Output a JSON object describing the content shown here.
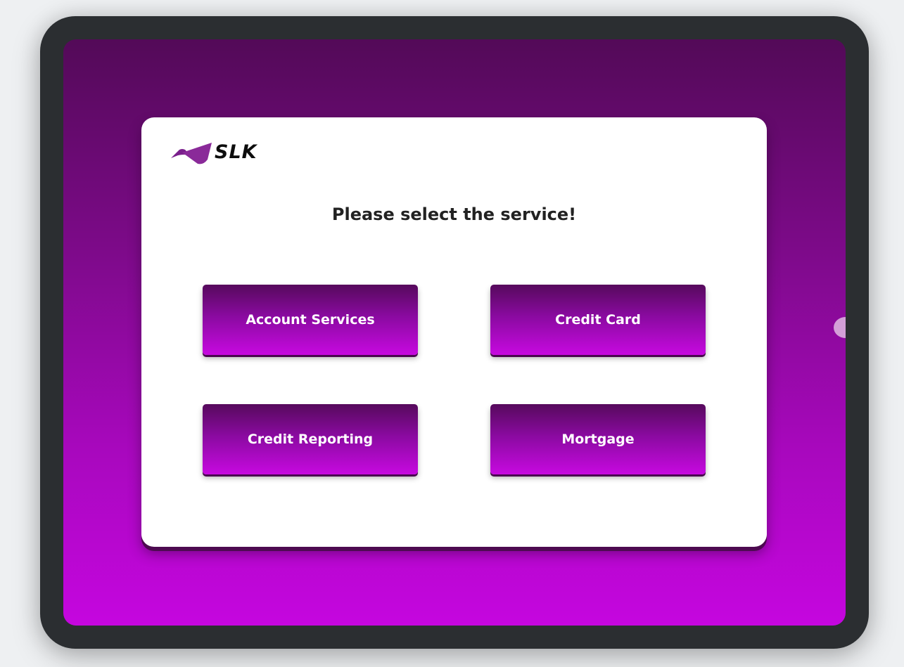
{
  "logo": {
    "text": "SLK",
    "accent_color": "#8a2a99"
  },
  "main": {
    "title": "Please select the service!"
  },
  "services": [
    {
      "label": "Account Services"
    },
    {
      "label": "Credit Card"
    },
    {
      "label": "Credit Reporting"
    },
    {
      "label": "Mortgage"
    }
  ],
  "colors": {
    "device_frame": "#2b2e31",
    "background_top": "#530a58",
    "background_bottom": "#c506df",
    "button_top": "#560a5c",
    "button_bottom": "#c709e0",
    "card": "#ffffff"
  }
}
